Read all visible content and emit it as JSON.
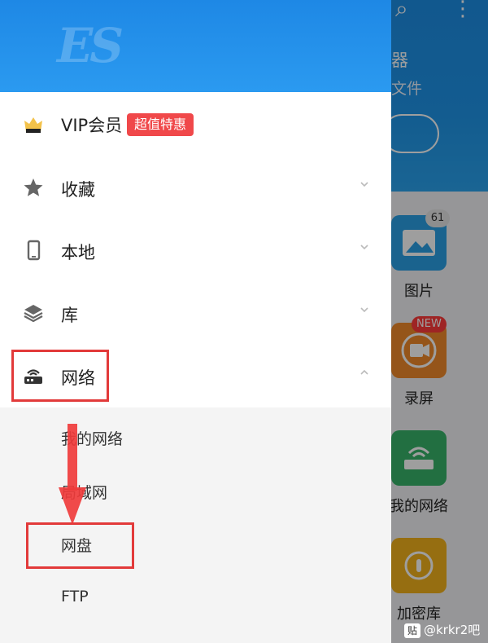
{
  "drawer": {
    "logo_text": "ES",
    "vip": {
      "label": "VIP会员",
      "badge": "超值特惠"
    },
    "menu": [
      {
        "label": "收藏",
        "icon": "star-icon"
      },
      {
        "label": "本地",
        "icon": "phone-icon"
      },
      {
        "label": "库",
        "icon": "layers-icon"
      },
      {
        "label": "网络",
        "icon": "router-icon"
      }
    ],
    "network_sub": [
      "我的网络",
      "局域网",
      "网盘",
      "FTP"
    ]
  },
  "background": {
    "title_fragment": "器",
    "subtitle_fragment": "文件",
    "tiles": [
      {
        "label": "图片",
        "badge": "61",
        "color": "#2aa0e6"
      },
      {
        "label": "录屏",
        "badge": "NEW",
        "color": "#f08a2a"
      },
      {
        "label": "我的网络",
        "color": "#38b36a"
      },
      {
        "label": "加密库",
        "color": "#f2b21c"
      }
    ]
  },
  "watermark": {
    "logo": "贴",
    "text": "@krkr2吧"
  },
  "colors": {
    "accent_blue": "#1e88e5",
    "highlight_red": "#e23a3a",
    "vip_badge": "#f0484a"
  }
}
